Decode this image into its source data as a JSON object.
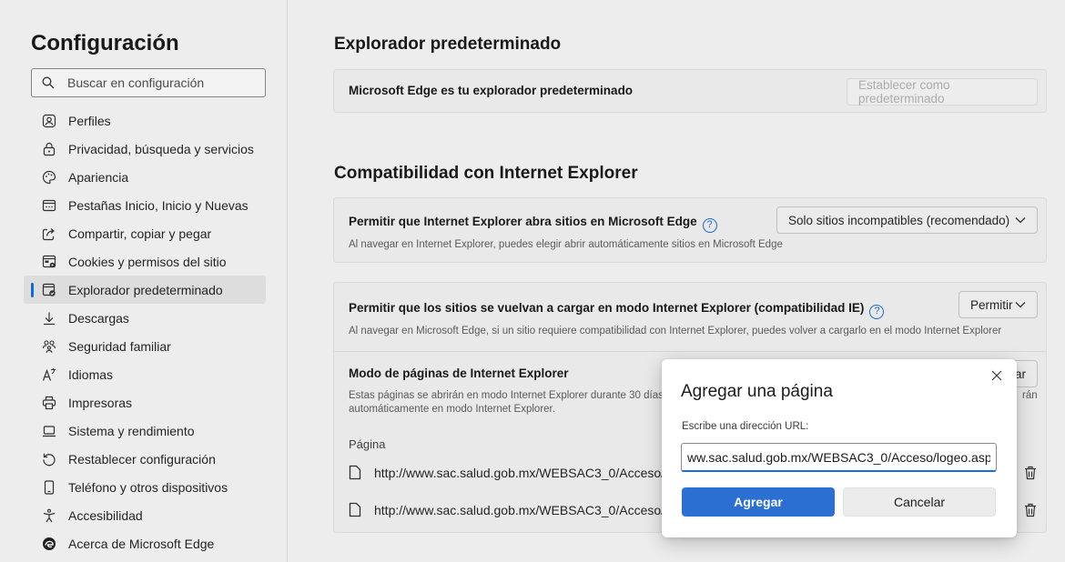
{
  "sidebar": {
    "title": "Configuración",
    "search_placeholder": "Buscar en configuración",
    "items": [
      {
        "label": "Perfiles",
        "icon": "profile-icon"
      },
      {
        "label": "Privacidad, búsqueda y servicios",
        "icon": "lock-icon"
      },
      {
        "label": "Apariencia",
        "icon": "palette-icon"
      },
      {
        "label": "Pestañas Inicio, Inicio y Nuevas",
        "icon": "tabs-icon"
      },
      {
        "label": "Compartir, copiar y pegar",
        "icon": "share-icon"
      },
      {
        "label": "Cookies y permisos del sitio",
        "icon": "cookies-icon"
      },
      {
        "label": "Explorador predeterminado",
        "icon": "browser-icon",
        "active": true
      },
      {
        "label": "Descargas",
        "icon": "download-icon"
      },
      {
        "label": "Seguridad familiar",
        "icon": "family-icon"
      },
      {
        "label": "Idiomas",
        "icon": "language-icon"
      },
      {
        "label": "Impresoras",
        "icon": "printer-icon"
      },
      {
        "label": "Sistema y rendimiento",
        "icon": "laptop-icon"
      },
      {
        "label": "Restablecer configuración",
        "icon": "reset-icon"
      },
      {
        "label": "Teléfono y otros dispositivos",
        "icon": "phone-icon"
      },
      {
        "label": "Accesibilidad",
        "icon": "accessibility-icon"
      },
      {
        "label": "Acerca de Microsoft Edge",
        "icon": "edge-icon"
      }
    ]
  },
  "main": {
    "default_browser": {
      "heading": "Explorador predeterminado",
      "status": "Microsoft Edge es tu explorador predeterminado",
      "set_default_label": "Establecer como predeterminado"
    },
    "ie_compat": {
      "heading": "Compatibilidad con Internet Explorer",
      "allow_ie_open": {
        "title": "Permitir que Internet Explorer abra sitios en Microsoft Edge",
        "desc": "Al navegar en Internet Explorer, puedes elegir abrir automáticamente sitios en Microsoft Edge",
        "select_value": "Solo sitios incompatibles (recomendado)"
      },
      "allow_reload": {
        "title": "Permitir que los sitios se vuelvan a cargar en modo Internet Explorer (compatibilidad IE)",
        "desc": "Al navegar en Microsoft Edge, si un sitio requiere compatibilidad con Internet Explorer, puedes volver a cargarlo en el modo Internet Explorer",
        "select_value": "Permitir"
      },
      "ie_pages": {
        "title": "Modo de páginas de Internet Explorer",
        "desc_line1": "Estas páginas se abrirán en modo Internet Explorer durante 30 días",
        "desc_line2": "automáticamente en modo Internet Explorer.",
        "desc_tail": "rán",
        "add_button_partial": "egar",
        "column_header": "Página",
        "pages": [
          {
            "url": "http://www.sac.salud.gob.mx/WEBSAC3_0/Acceso/lo"
          },
          {
            "url": "http://www.sac.salud.gob.mx/WEBSAC3_0/Acceso/se"
          }
        ]
      }
    }
  },
  "dialog": {
    "title": "Agregar una página",
    "label": "Escribe una dirección URL:",
    "input_value": "ww.sac.salud.gob.mx/WEBSAC3_0/Acceso/logeo.aspx",
    "add_label": "Agregar",
    "cancel_label": "Cancelar"
  },
  "colors": {
    "accent": "#1a6ed8",
    "primary_button": "#2b6fd3"
  }
}
